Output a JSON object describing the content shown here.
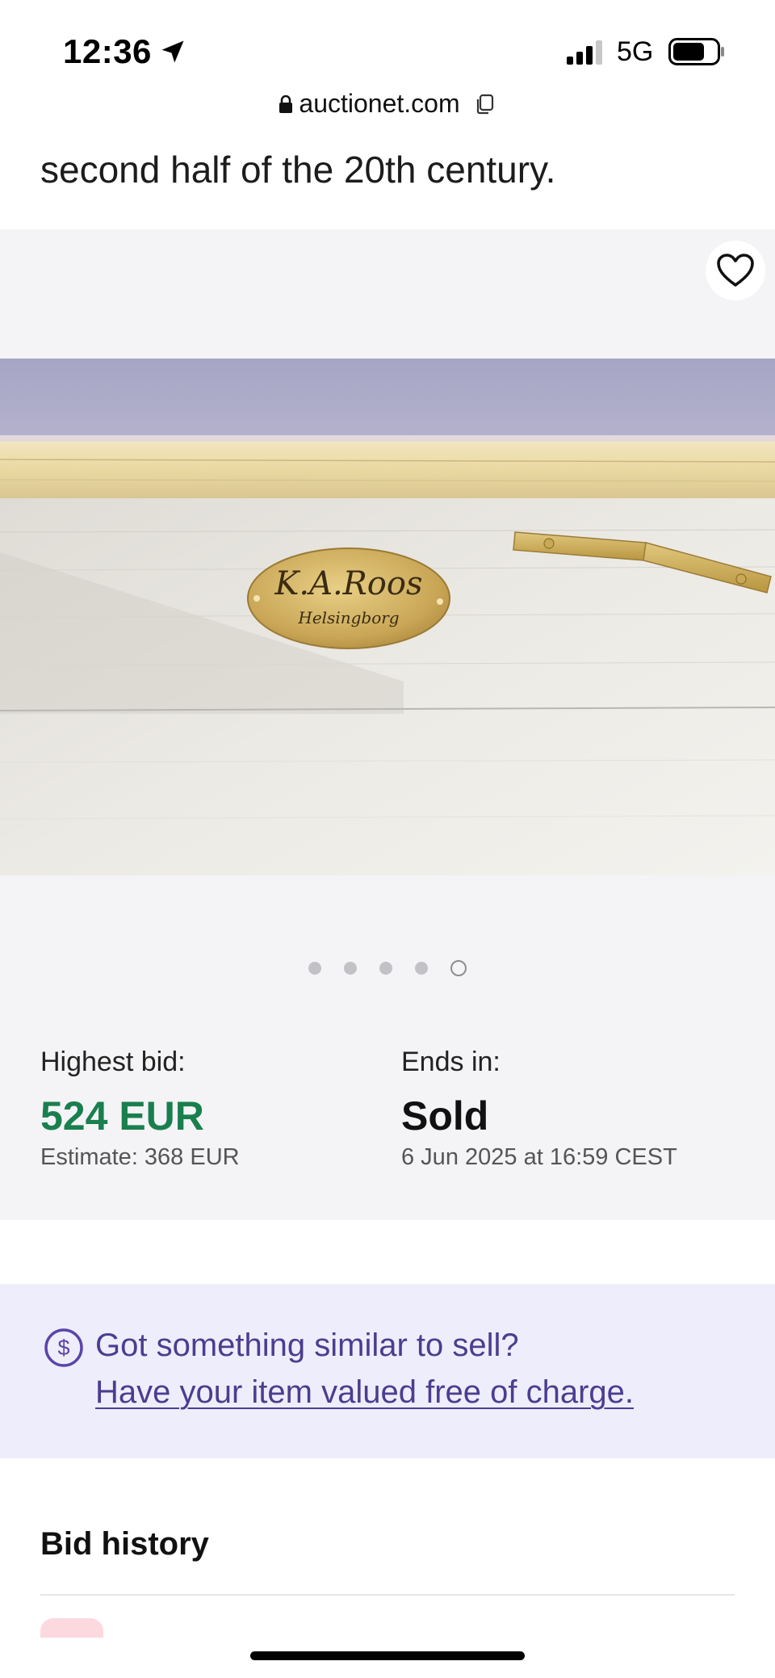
{
  "status_bar": {
    "time": "12:36",
    "network": "5G",
    "icons": [
      "location-arrow-icon",
      "signal-bars-icon",
      "battery-icon"
    ]
  },
  "browser": {
    "url": "auctionet.com",
    "icons": [
      "lock-icon",
      "copy-icon"
    ]
  },
  "description": {
    "text": "second half of the 20th century."
  },
  "gallery": {
    "image_count": 5,
    "active_index": 5,
    "plaque_line1": "K.A.Roos",
    "plaque_line2": "Helsingborg"
  },
  "bid_info": {
    "highest_bid_label": "Highest bid:",
    "highest_bid_value": "524 EUR",
    "estimate": "Estimate: 368 EUR",
    "ends_label": "Ends in:",
    "ends_value": "Sold",
    "ends_date": "6 Jun 2025 at 16:59 CEST"
  },
  "sell_banner": {
    "title": "Got something similar to sell?",
    "link": "Have your item valued free of charge."
  },
  "bid_history": {
    "title": "Bid history"
  },
  "colors": {
    "bid_green": "#1a7f4e",
    "banner_bg": "#eeedfb",
    "banner_text": "#4c3d8f",
    "gallery_bg": "#f4f4f6"
  }
}
